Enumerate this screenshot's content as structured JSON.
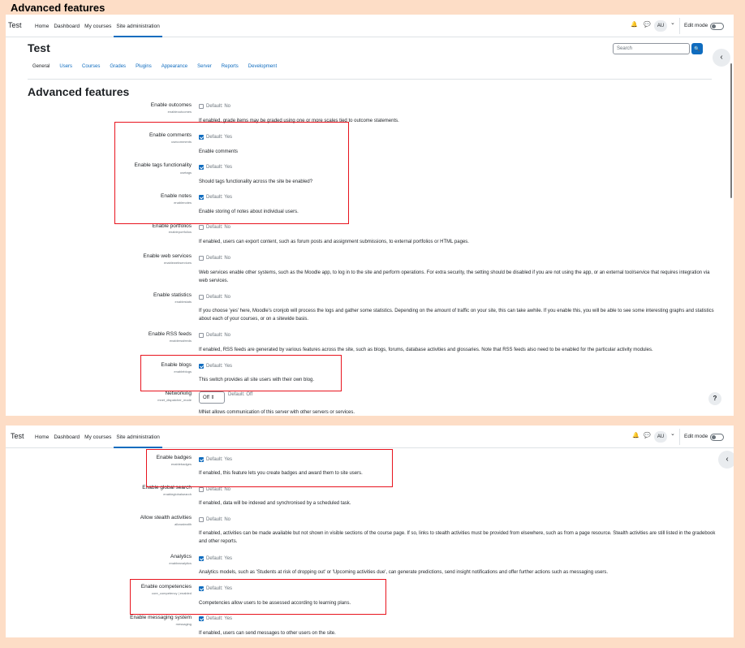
{
  "document_title": "Advanced features",
  "navbar": {
    "brand": "Test",
    "links": [
      "Home",
      "Dashboard",
      "My courses",
      "Site administration"
    ],
    "active_link": "Site administration",
    "bell_glyph": "🔔",
    "chat_glyph": "💬",
    "avatar_initials": "AU",
    "avatar_chevron": "⌄",
    "edit_mode_label": "Edit mode"
  },
  "page": {
    "title": "Test",
    "search_placeholder": "Search",
    "search_glyph": "🔍",
    "drawer_glyph": "‹",
    "tabs": [
      "General",
      "Users",
      "Courses",
      "Grades",
      "Plugins",
      "Appearance",
      "Server",
      "Reports",
      "Development"
    ],
    "active_tab": "General",
    "section_title": "Advanced features",
    "help_glyph": "?"
  },
  "settings_panel1": [
    {
      "label": "Enable outcomes",
      "name": "enableoutcomes",
      "checked": false,
      "default": "Default: No",
      "description": "If enabled, grade items may be graded using one or more scales tied to outcome statements."
    },
    {
      "label": "Enable comments",
      "name": "usecomments",
      "checked": true,
      "default": "Default: Yes",
      "description": "Enable comments"
    },
    {
      "label": "Enable tags functionality",
      "name": "usetags",
      "checked": true,
      "default": "Default: Yes",
      "description": "Should tags functionality across the site be enabled?"
    },
    {
      "label": "Enable notes",
      "name": "enablenotes",
      "checked": true,
      "default": "Default: Yes",
      "description": "Enable storing of notes about individual users."
    },
    {
      "label": "Enable portfolios",
      "name": "enableportfolios",
      "checked": false,
      "default": "Default: No",
      "description": "If enabled, users can export content, such as forum posts and assignment submissions, to external portfolios or HTML pages."
    },
    {
      "label": "Enable web services",
      "name": "enablewebservices",
      "checked": false,
      "default": "Default: No",
      "description": "Web services enable other systems, such as the Moodle app, to log in to the site and perform operations. For extra security, the setting should be disabled if you are not using the app, or an external tool/service that requires integration via web services."
    },
    {
      "label": "Enable statistics",
      "name": "enablestats",
      "checked": false,
      "default": "Default: No",
      "description": "If you choose 'yes' here, Moodle's cronjob will process the logs and gather some statistics. Depending on the amount of traffic on your site, this can take awhile. If you enable this, you will be able to see some interesting graphs and statistics about each of your courses, or on a sitewide basis."
    },
    {
      "label": "Enable RSS feeds",
      "name": "enablerssfeeds",
      "checked": false,
      "default": "Default: No",
      "description": "If enabled, RSS feeds are generated by various features across the site, such as blogs, forums, database activities and glossaries. Note that RSS feeds also need to be enabled for the particular activity modules."
    },
    {
      "label": "Enable blogs",
      "name": "enableblogs",
      "checked": true,
      "default": "Default: Yes",
      "description": "This switch provides all site users with their own blog."
    }
  ],
  "networking": {
    "label": "Networking",
    "name": "mnet_dispatcher_mode",
    "select_value": "Off ⇕",
    "default": "Default: Off",
    "description": "MNet allows communication of this server with other servers or services."
  },
  "settings_panel2": [
    {
      "label": "Enable badges",
      "name": "enablebadges",
      "checked": true,
      "default": "Default: Yes",
      "description": "If enabled, this feature lets you create badges and award them to site users."
    },
    {
      "label": "Enable global search",
      "name": "enableglobalsearch",
      "checked": false,
      "default": "Default: No",
      "description": "If enabled, data will be indexed and synchronised by a scheduled task."
    },
    {
      "label": "Allow stealth activities",
      "name": "allowstealth",
      "checked": false,
      "default": "Default: No",
      "description": "If enabled, activities can be made available but not shown in visible sections of the course page. If so, links to stealth activities must be provided from elsewhere, such as from a page resource. Stealth activities are still listed in the gradebook and other reports."
    },
    {
      "label": "Analytics",
      "name": "enableanalytics",
      "checked": true,
      "default": "Default: Yes",
      "description": "Analytics models, such as 'Students at risk of dropping out' or 'Upcoming activities due', can generate predictions, send insight notifications and offer further actions such as messaging users."
    },
    {
      "label": "Enable competencies",
      "name": "core_competency | enabled",
      "checked": true,
      "default": "Default: Yes",
      "description": "Competencies allow users to be assessed according to learning plans."
    },
    {
      "label": "Enable messaging system",
      "name": "messaging",
      "checked": true,
      "default": "Default: Yes",
      "description": "If enabled, users can send messages to other users on the site."
    }
  ],
  "colors": {
    "highlight": "#e8141e",
    "accent": "#0f6cbf",
    "background": "#fdddc6"
  }
}
